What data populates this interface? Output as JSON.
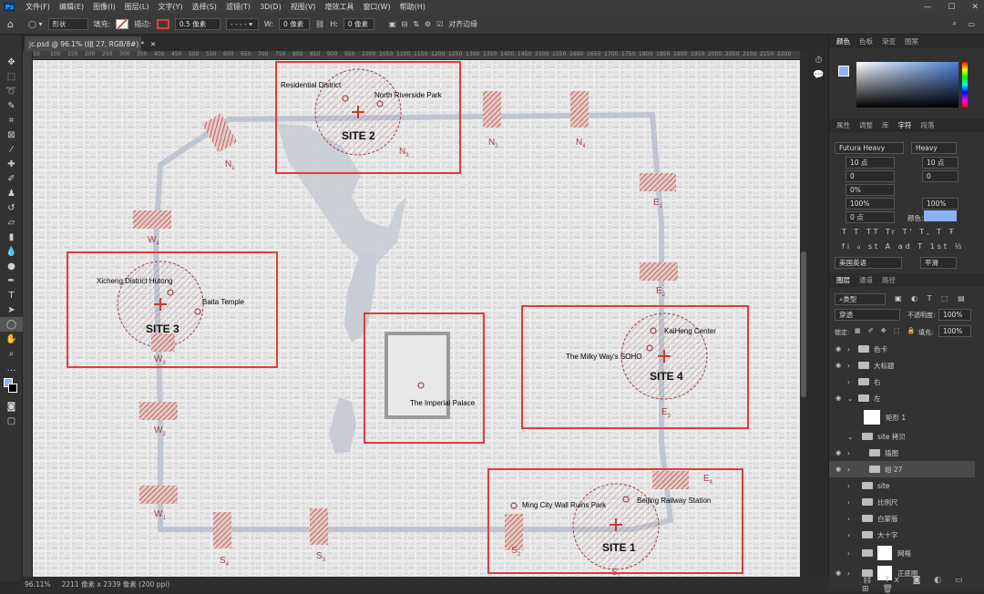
{
  "menubar": {
    "app_icon": "Ps",
    "items": [
      "文件(F)",
      "编辑(E)",
      "图像(I)",
      "图层(L)",
      "文字(Y)",
      "选择(S)",
      "滤镜(T)",
      "3D(D)",
      "视图(V)",
      "增效工具",
      "窗口(W)",
      "帮助(H)"
    ]
  },
  "options": {
    "mode": "形状",
    "fill_label": "填充:",
    "stroke_label": "描边:",
    "stroke_width": "0.5 像素",
    "w_label": "W:",
    "w_value": "0 像素",
    "h_label": "H:",
    "h_value": "0 像素",
    "align_edges": "对齐边缘"
  },
  "document": {
    "tab_title": "jc.psd @ 96.1% (组 27, RGB/8#) *",
    "status_zoom": "96.11%",
    "status_info": "2211 像素 x 2339 像素 (200 ppi)"
  },
  "ruler_ticks": [
    "50",
    "100",
    "150",
    "200",
    "250",
    "300",
    "350",
    "400",
    "450",
    "500",
    "550",
    "600",
    "650",
    "700",
    "750",
    "800",
    "850",
    "900",
    "950",
    "1000",
    "1050",
    "1100",
    "1150",
    "1200",
    "1250",
    "1300",
    "1350",
    "1400",
    "1450",
    "1500",
    "1550",
    "1600",
    "1650",
    "1700",
    "1750",
    "1800",
    "1850",
    "1900",
    "1950",
    "2000",
    "2050",
    "2100",
    "2150",
    "2200"
  ],
  "map": {
    "sites": [
      {
        "title": "SITE 2",
        "labels": [
          "Residential District",
          "North Riverside Park"
        ]
      },
      {
        "title": "SITE 3",
        "labels": [
          "Xicheng District Hutong",
          "Baita Temple"
        ]
      },
      {
        "title": "SITE 4",
        "labels": [
          "KaiHeng Center",
          "The Milky Way's SOHO"
        ]
      },
      {
        "title": "SITE 1",
        "labels": [
          "Ming City Wall Ruins Park",
          "Beijing Railway Station"
        ]
      }
    ],
    "imperial": "The Imperial Palace",
    "nodes": {
      "N1": "N",
      "N1s": "1",
      "N2": "N",
      "N2s": "2",
      "N3": "N",
      "N3s": "3",
      "N4": "N",
      "N4s": "4",
      "W4": "W",
      "W4s": "4",
      "W3": "W",
      "W3s": "3",
      "W2": "W",
      "W2s": "2",
      "W1": "W",
      "W1s": "1",
      "E1": "E",
      "E1s": "1",
      "E2": "E",
      "E2s": "2",
      "E3": "E",
      "E3s": "3",
      "E4": "E",
      "E4s": "4",
      "S1": "S",
      "S1s": "1",
      "S2": "S",
      "S2s": "2",
      "S3": "S",
      "S3s": "3",
      "S4": "S",
      "S4s": "4"
    },
    "colors": {
      "accent": "#e23b3b",
      "hatch": "#a04040",
      "road": "#b8c0cc"
    }
  },
  "panels": {
    "color_tabs": [
      "颜色",
      "色板",
      "渐变",
      "图案"
    ],
    "char_tabs": [
      "属性",
      "调整",
      "库",
      "字符",
      "段落"
    ],
    "font_family": "Futura Heavy",
    "font_style": "Heavy",
    "font_size": "10 点",
    "leading": "10 点",
    "kerning": "0",
    "tracking": "0",
    "scale_pct": "0%",
    "vscale": "100%",
    "hscale": "100%",
    "baseline": "0 点",
    "color_label": "颜色:",
    "lang": "美国英语",
    "aa": "平滑",
    "layers_tabs": [
      "图层",
      "通道",
      "路径"
    ],
    "kind": "类型",
    "blend": "穿透",
    "opacity_label": "不透明度:",
    "opacity": "100%",
    "lock_label": "锁定:",
    "fill_label": "填充:",
    "fill": "100%",
    "layers": [
      "色卡",
      "大标题",
      "右",
      "左",
      "矩形 1",
      "site 拷贝",
      "插图",
      "组 27",
      "site",
      "比例尺",
      "白蒙版",
      "大十字",
      "网格",
      "正底图"
    ]
  }
}
